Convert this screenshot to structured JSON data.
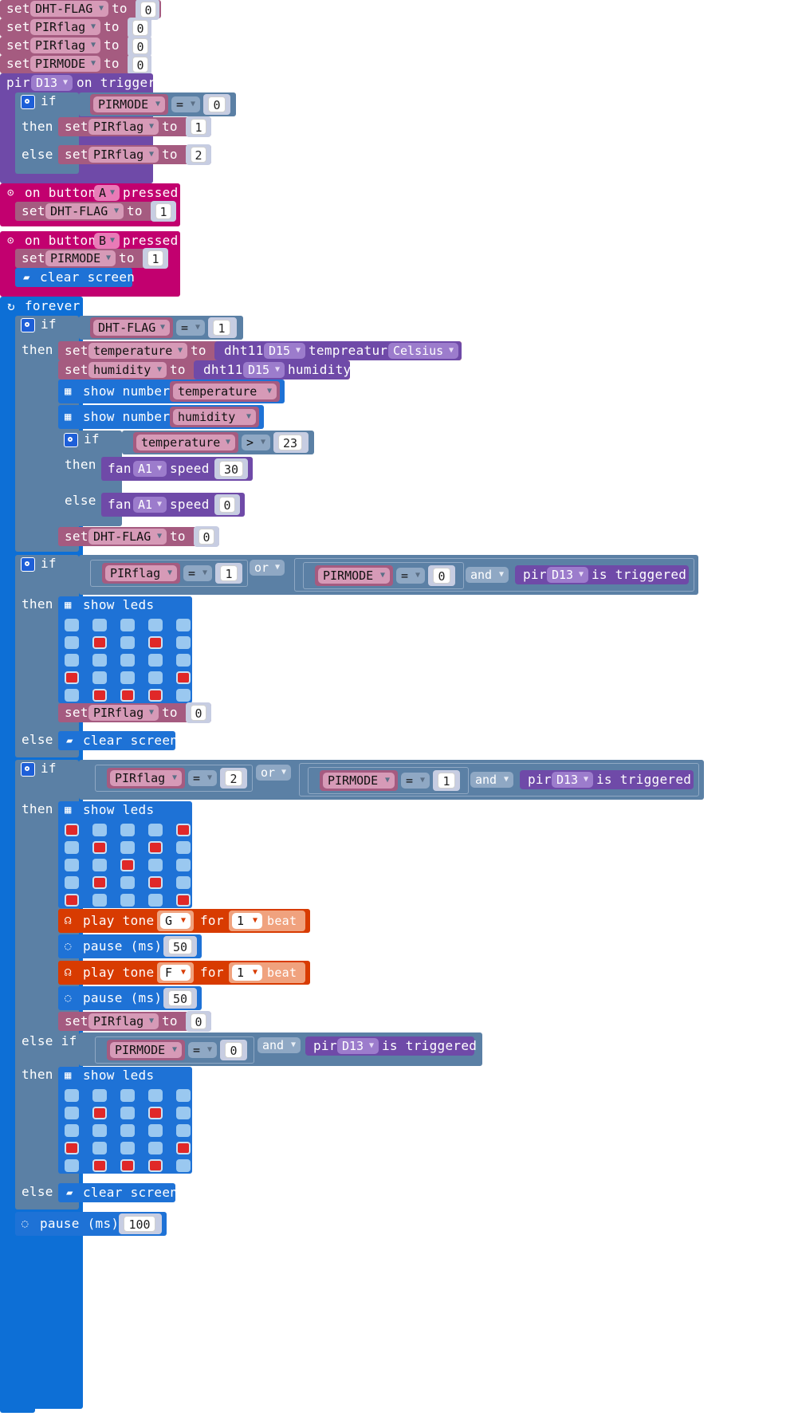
{
  "colors": {
    "variable": "#a55b80",
    "var_pill": "#c57396",
    "dd_var": "#d69ab7",
    "logic": "#5b80a5",
    "logic_dd": "#8fa8c4",
    "number_shell": "#c7cde2",
    "input": "#c2006f",
    "basic": "#1e72d6",
    "loops": "#0d6fd6",
    "plugin": "#6f4aa8",
    "plugin_dd": "#9c7ccc",
    "music": "#d83b01",
    "music_light": "#f0a27e",
    "leds_on": "#e02828",
    "leds_off": "#9ac8f0"
  },
  "top": {
    "set_word": "set",
    "to_word": "to",
    "rows": [
      {
        "var": "DHT-FLAG",
        "value": "0"
      },
      {
        "var": "PIRflag",
        "value": "0"
      },
      {
        "var": "PIRflag",
        "value": "0"
      },
      {
        "var": "PIRMODE",
        "value": "0"
      }
    ]
  },
  "pir": {
    "label": "pir",
    "pin": "D13",
    "suffix": "on trigger",
    "if_word": "if",
    "then_word": "then",
    "else_word": "else",
    "cond_var": "PIRMODE",
    "cond_op": "=",
    "cond_val": "0",
    "then_var": "PIRflag",
    "then_val": "1",
    "else_var": "PIRflag",
    "else_val": "2"
  },
  "btnA": {
    "label": "on button",
    "button": "A",
    "suffix": "pressed",
    "var": "DHT-FLAG",
    "value": "1"
  },
  "btnB": {
    "label": "on button",
    "button": "B",
    "suffix": "pressed",
    "var": "PIRMODE",
    "value": "1",
    "clear": "clear screen"
  },
  "forever": {
    "label": "forever",
    "if1": {
      "cond_var": "DHT-FLAG",
      "cond_op": "=",
      "cond_val": "1",
      "set_temp_var": "temperature",
      "dht_label": "dht11",
      "dht_pin": "D15",
      "dht_reading": "tempreature",
      "dht_unit": "Celsius",
      "set_hum_var": "humidity",
      "dht_reading2": "humidity",
      "show_number": "show number",
      "show_var1": "temperature",
      "show_var2": "humidity",
      "inner_if_var": "temperature",
      "inner_if_op": ">",
      "inner_if_val": "23",
      "fan_label": "fan",
      "fan_pin": "A1",
      "speed_label": "speed",
      "fan_then": "30",
      "fan_else": "0",
      "reset_var": "DHT-FLAG",
      "reset_val": "0"
    },
    "if2": {
      "var1": "PIRflag",
      "op1": "=",
      "val1": "1",
      "or_word": "or",
      "var2": "PIRMODE",
      "op2": "=",
      "val2": "0",
      "and_word": "and",
      "pir_label": "pir",
      "pir_pin": "D13",
      "pir_suffix": "is triggered",
      "show_leds": "show leds",
      "reset_var": "PIRflag",
      "reset_val": "0",
      "else_clear": "clear screen"
    },
    "if3": {
      "var1": "PIRflag",
      "op1": "=",
      "val1": "2",
      "or_word": "or",
      "var2": "PIRMODE",
      "op2": "=",
      "val2": "1",
      "and_word": "and",
      "pir_label": "pir",
      "pir_pin": "D13",
      "pir_suffix": "is triggered",
      "show_leds": "show leds",
      "tone_label": "play tone",
      "for_word": "for",
      "beat_word": "beat",
      "tone1": "G",
      "beats1": "1",
      "pause_label": "pause (ms)",
      "pause1": "50",
      "tone2": "F",
      "beats2": "1",
      "pause2": "50",
      "reset_var": "PIRflag",
      "reset_val": "0",
      "elseif_word": "else if",
      "ei_var": "PIRMODE",
      "ei_op": "=",
      "ei_val": "0",
      "ei_and": "and",
      "ei_pir": "pir",
      "ei_pin": "D13",
      "ei_suffix": "is triggered",
      "ei_show": "show leds",
      "else_clear": "clear screen"
    },
    "pause_label": "pause (ms)",
    "pause_val": "100"
  },
  "leds": {
    "smile": [
      [
        0,
        0,
        0,
        0,
        0
      ],
      [
        0,
        1,
        0,
        1,
        0
      ],
      [
        0,
        0,
        0,
        0,
        0
      ],
      [
        1,
        0,
        0,
        0,
        1
      ],
      [
        0,
        1,
        1,
        1,
        0
      ]
    ],
    "cross": [
      [
        1,
        0,
        0,
        0,
        1
      ],
      [
        0,
        1,
        0,
        1,
        0
      ],
      [
        0,
        0,
        1,
        0,
        0
      ],
      [
        0,
        1,
        0,
        1,
        0
      ],
      [
        1,
        0,
        0,
        0,
        1
      ]
    ],
    "smile2": [
      [
        0,
        0,
        0,
        0,
        0
      ],
      [
        0,
        1,
        0,
        1,
        0
      ],
      [
        0,
        0,
        0,
        0,
        0
      ],
      [
        1,
        0,
        0,
        0,
        1
      ],
      [
        0,
        1,
        1,
        1,
        0
      ]
    ]
  }
}
